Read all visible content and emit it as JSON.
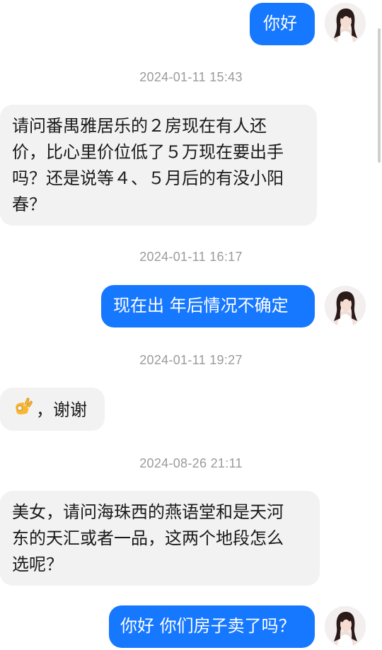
{
  "messages": {
    "m1": "你好",
    "t1": "2024-01-11 15:43",
    "m2_l1": "请问番禺雅居乐的２房现在有人还",
    "m2_l2": "价，比心里价位低了５万现在要出手",
    "m2_l3": "吗？还是说等４、５月后的有没小阳",
    "m2_l4": "春？",
    "t2": "2024-01-11 16:17",
    "m3": "现在出 年后情况不确定",
    "t3": "2024-01-11 19:27",
    "m4_text": "，谢谢",
    "t4": "2024-08-26 21:11",
    "m5_l1": "美女，请问海珠西的燕语堂和是天河",
    "m5_l2": "东的天汇或者一品，这两个地段怎么",
    "m5_l3": "选呢？",
    "m6": "你好 你们房子卖了吗？"
  },
  "icons": {
    "ok_hand": "ok-hand-emoji",
    "avatar": "user-avatar-photo"
  },
  "colors": {
    "outgoing_bubble": "#1677ff",
    "incoming_bubble": "#f2f2f2",
    "timestamp": "#9b9b9b"
  }
}
